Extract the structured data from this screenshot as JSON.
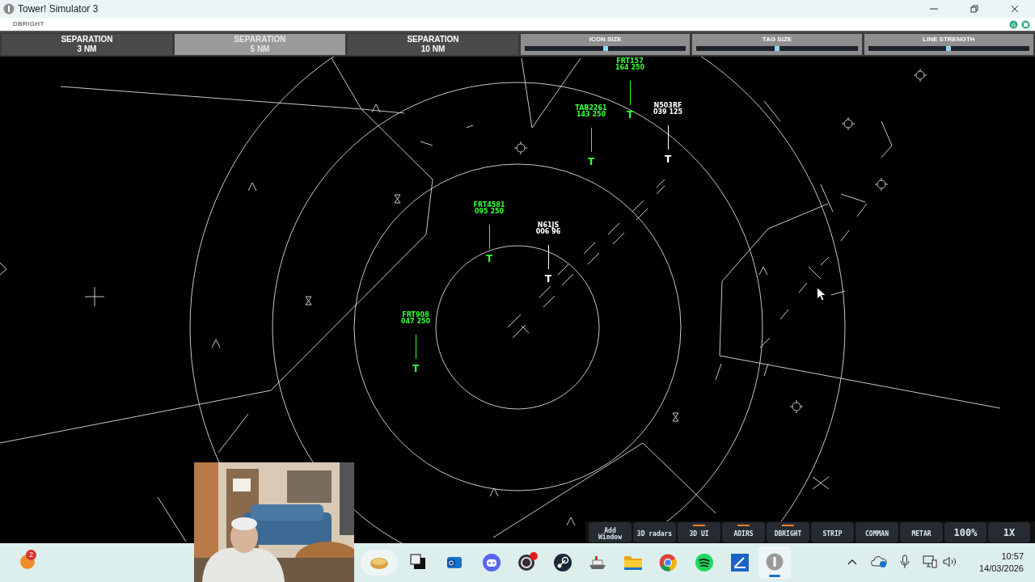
{
  "window": {
    "title": "Tower! Simulator 3"
  },
  "menu_label": "DBRIGHT",
  "separation_buttons": [
    {
      "label": "SEPARATION",
      "value": "3 NM",
      "selected": false
    },
    {
      "label": "SEPARATION",
      "value": "5 NM",
      "selected": true
    },
    {
      "label": "SEPARATION",
      "value": "10 NM",
      "selected": false
    }
  ],
  "sliders": [
    {
      "label": "ICON SIZE",
      "level": 0.5
    },
    {
      "label": "TAG SIZE",
      "level": 0.5
    },
    {
      "label": "LINE STRENGTH",
      "level": 0.5
    }
  ],
  "targets": [
    {
      "callsign": "FRT157",
      "readout": "164 250",
      "symbol": "T",
      "color": "#33ff33"
    },
    {
      "callsign": "TAB2261",
      "readout": "143 250",
      "symbol": "T",
      "color": "#33ff33"
    },
    {
      "callsign": "N503RF",
      "readout": "039 125",
      "symbol": "T",
      "color": "#ffffff"
    },
    {
      "callsign": "FRT4581",
      "readout": "095 250",
      "symbol": "T",
      "color": "#33ff33"
    },
    {
      "callsign": "N61JS",
      "readout": "006 96",
      "symbol": "T",
      "color": "#ffffff"
    },
    {
      "callsign": "FRT908",
      "readout": "047 250",
      "symbol": "T",
      "color": "#33ff33"
    }
  ],
  "bottom_toolbar": [
    {
      "label": "Add Window",
      "indicator": false
    },
    {
      "label": "3D radars",
      "indicator": false
    },
    {
      "label": "3D UI",
      "indicator": true
    },
    {
      "label": "ADIRS",
      "indicator": true
    },
    {
      "label": "DBRIGHT",
      "indicator": true
    },
    {
      "label": "STRIP",
      "indicator": false
    },
    {
      "label": "COMMAN",
      "indicator": false
    },
    {
      "label": "METAR",
      "indicator": false
    },
    {
      "label": "100%",
      "indicator": false
    },
    {
      "label": "1X",
      "indicator": false
    }
  ],
  "taskbar": {
    "badge": "2",
    "time": "10:57",
    "date": "14/03/2026"
  }
}
